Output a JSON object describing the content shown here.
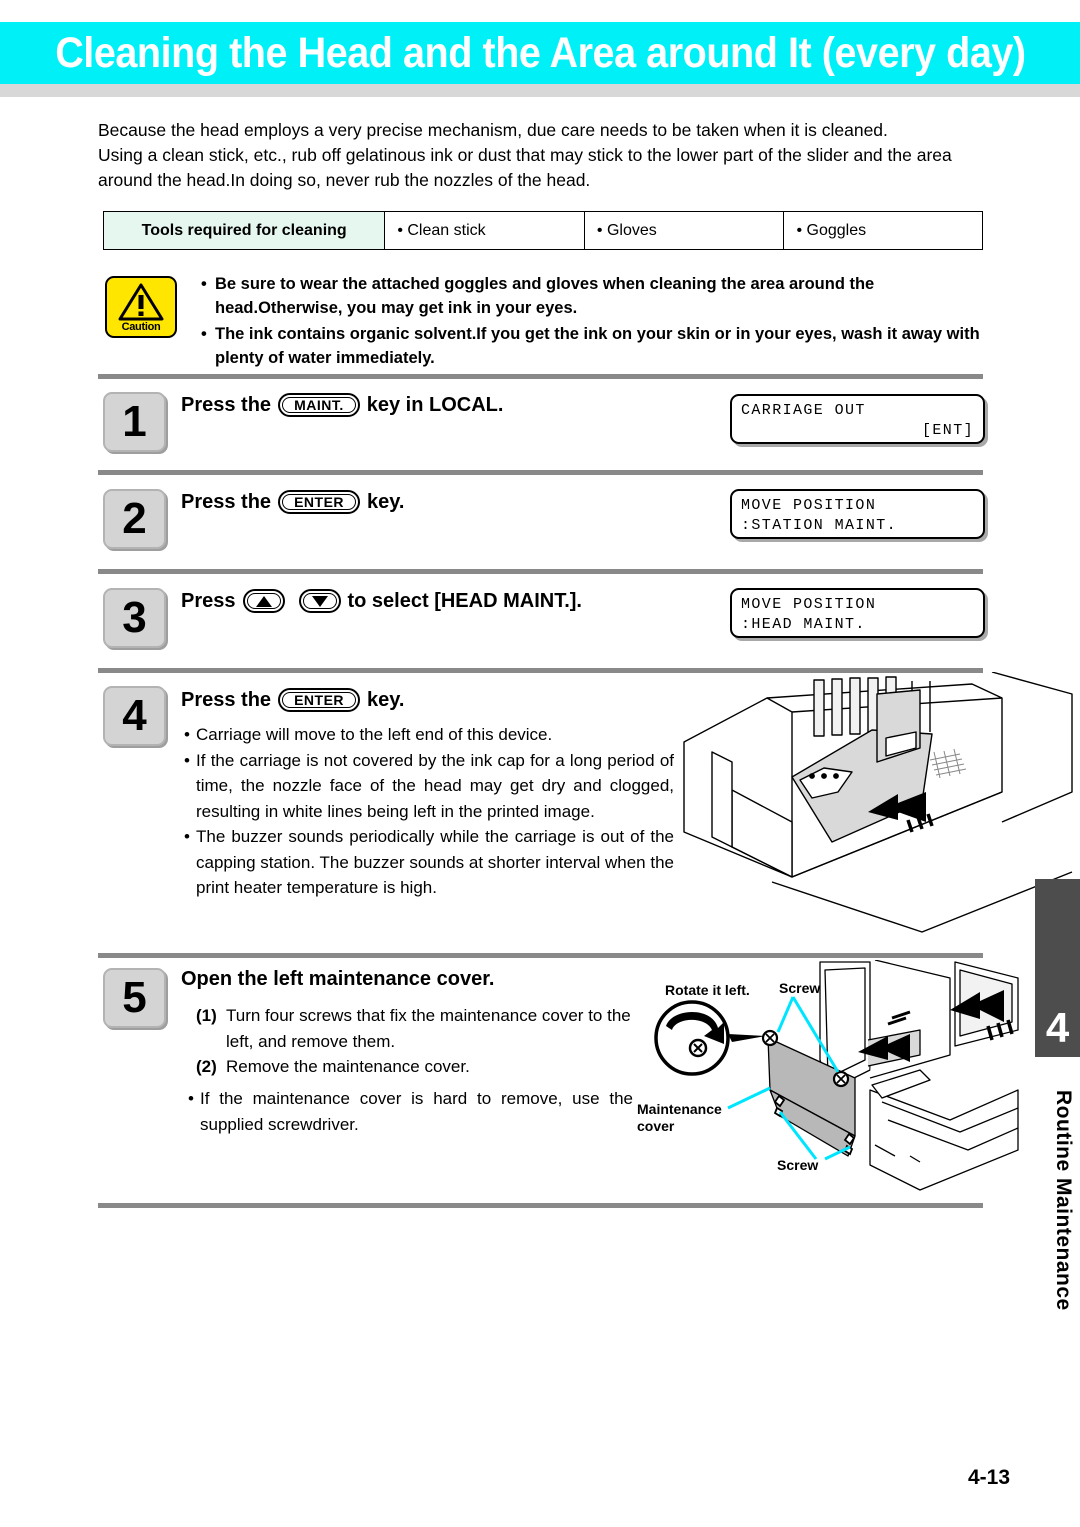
{
  "header": {
    "title": "Cleaning the Head and the Area around It (every day)",
    "banner_color": "#00f0f8",
    "title_color": "#ffffff"
  },
  "intro": {
    "lines": [
      "Because the head employs a very precise mechanism, due care needs to be taken when it is cleaned.",
      "Using a clean stick, etc., rub off gelatinous ink or dust that may stick to the lower part of the slider and the area",
      "around the head.In doing so, never rub the nozzles of the head."
    ]
  },
  "tools_table": {
    "header": "Tools required for cleaning",
    "header_bg": "#e6f7f0",
    "items": [
      "• Clean stick",
      "• Gloves",
      "• Goggles"
    ]
  },
  "caution": {
    "icon_label": "Caution",
    "icon_bg": "#ffe600",
    "bullets": [
      "Be sure to wear the attached goggles and gloves when cleaning the area around the head.Otherwise, you may get ink in your eyes.",
      "The ink contains organic solvent.If you get the ink on your skin or in your eyes, wash it away with plenty of water immediately."
    ],
    "bullet_char": "•"
  },
  "steps": [
    {
      "number": "1",
      "title_prefix": "Press the",
      "key": "MAINT.",
      "title_suffix": "key in LOCAL.",
      "lcd": {
        "line1": "CARRIAGE OUT",
        "line2": "[ENT]"
      }
    },
    {
      "number": "2",
      "title_prefix": "Press the",
      "key": "ENTER",
      "title_suffix": "key.",
      "lcd": {
        "line1": "MOVE POSITION",
        "line2": ":STATION MAINT."
      }
    },
    {
      "number": "3",
      "title_prefix": "Press",
      "key_up": "up-arrow",
      "key_down": "down-arrow",
      "title_suffix": "to select [HEAD MAINT.].",
      "lcd": {
        "line1": "MOVE POSITION",
        "line2": ":HEAD MAINT."
      }
    },
    {
      "number": "4",
      "title_prefix": "Press the",
      "key": "ENTER",
      "title_suffix": "key.",
      "bullets": [
        "Carriage will move to the left end of this device.",
        "If the carriage is not covered by the ink cap for a long period of time, the nozzle face of the head may get dry and clogged, resulting in white lines being left in the printed image.",
        "The buzzer sounds periodically while the carriage is out of the capping station. The buzzer sounds at shorter interval when the print heater temperature is high."
      ]
    },
    {
      "number": "5",
      "title": "Open the left maintenance cover.",
      "numbered": [
        {
          "n": "(1)",
          "t": "Turn four screws that fix the maintenance cover to the left, and remove them."
        },
        {
          "n": "(2)",
          "t": "Remove the maintenance cover."
        }
      ],
      "bullets": [
        "If the maintenance cover is hard to remove, use the supplied screwdriver."
      ],
      "figure_labels": {
        "rotate": "Rotate it left.",
        "screw_top": "Screw",
        "screw_bottom": "Screw",
        "cover_line1": "Maintenance",
        "cover_line2": "cover"
      }
    }
  ],
  "side_tab": {
    "number": "4",
    "label": "Routine Maintenance",
    "block_color": "#4d4d4d"
  },
  "footer": {
    "page_number": "4-13"
  }
}
